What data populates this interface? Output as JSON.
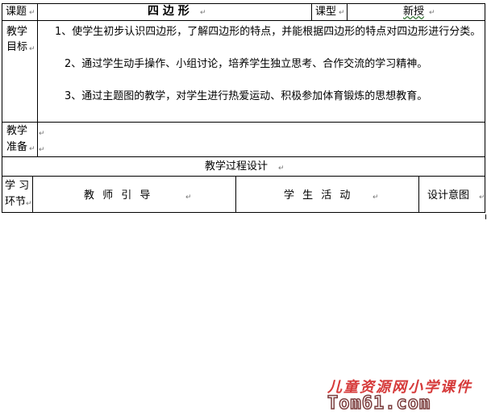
{
  "header": {
    "topic_label": "课题",
    "topic_value": "四 边 形",
    "type_label": "课型",
    "type_value": "新授"
  },
  "objectives": {
    "label_line1": "教学",
    "label_line2": "目标",
    "items": [
      "1、使学生初步认识四边形，了解四边形的特点，并能根据四边形的特点对四边形进行分类。",
      "2、通过学生动手操作、小组讨论，培养学生独立思考、合作交流的学习精神。",
      "3、通过主题图的教学，对学生进行热爱运动、积极参加体育锻炼的思想教育。"
    ]
  },
  "preparation": {
    "label_line1": "教学",
    "label_line2": "准备",
    "content": ""
  },
  "process": {
    "title": "教学过程设计",
    "col_stage_line1": "学 习",
    "col_stage_line2": "环节",
    "col_teacher": "教  师  引  导",
    "col_student": "学  生  活  动",
    "col_intent": "设计意图"
  },
  "watermark": {
    "site_name": "儿童资源网小学课件",
    "site_url": "Tom61.com"
  }
}
